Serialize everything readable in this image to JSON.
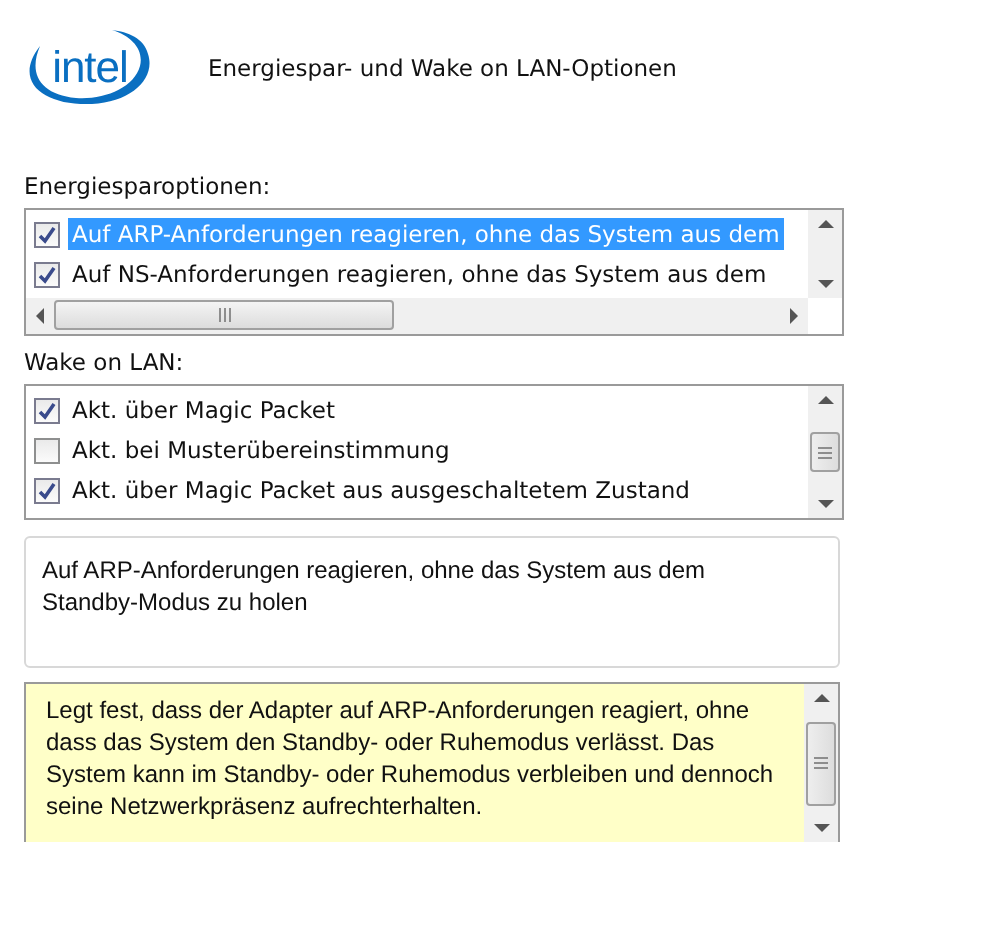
{
  "header": {
    "logo": "intel",
    "title": "Energiespar- und Wake on LAN-Optionen"
  },
  "energy_options": {
    "label": "Energiesparoptionen:",
    "items": [
      {
        "label": "Auf ARP-Anforderungen reagieren, ohne das System aus dem",
        "checked": true,
        "selected": true
      },
      {
        "label": "Auf NS-Anforderungen reagieren, ohne das System aus dem",
        "checked": true,
        "selected": false
      }
    ]
  },
  "wake_on_lan": {
    "label": "Wake on LAN:",
    "items": [
      {
        "label": "Akt. über Magic Packet",
        "checked": true,
        "selected": false
      },
      {
        "label": "Akt. bei Musterübereinstimmung",
        "checked": false,
        "selected": false
      },
      {
        "label": "Akt. über Magic Packet aus ausgeschaltetem Zustand",
        "checked": true,
        "selected": false
      }
    ]
  },
  "summary": "Auf ARP-Anforderungen reagieren, ohne das System aus dem Standby-Modus zu holen",
  "help_text": "Legt fest, dass der Adapter auf ARP-Anforderungen reagiert, ohne dass das System den Standby- oder Ruhemodus verlässt. Das System kann im Standby- oder Ruhemodus verbleiben und dennoch seine Netzwerkpräsenz aufrechterhalten."
}
